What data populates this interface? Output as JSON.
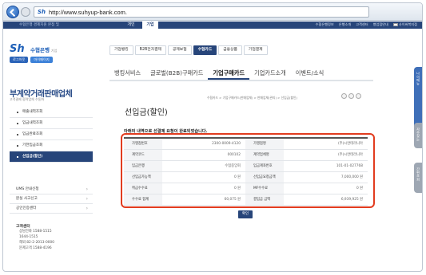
{
  "browser": {
    "url": "http://www.suhyup-bank.com."
  },
  "top": {
    "brand_note": "수협은행 경제지원 본점 및",
    "tab_personal": "개인",
    "tab_corporate": "기업",
    "links": [
      "수협은행정보",
      "은행소개",
      "고객센터",
      "병업점안내",
      "사이버북지점"
    ]
  },
  "logo": {
    "mark": "Sh",
    "name": "수협은행",
    "sub": "기업"
  },
  "logo_buttons": {
    "login": "로그아웃",
    "mypage": "마이페이지"
  },
  "sidebar": {
    "title": "부계약거래판매업체",
    "subtitle": "고객결제 협력업체 수동화",
    "items": [
      {
        "label": "매출내역조회",
        "active": false
      },
      {
        "label": "입금내역조회",
        "active": false
      },
      {
        "label": "입금완료조회",
        "active": false
      },
      {
        "label": "기한입금조회",
        "active": false
      },
      {
        "label": "선입금(할인)",
        "active": true
      }
    ],
    "secondary": [
      "UMS 안내신청",
      "분실 사고신고",
      "공인인증센터"
    ],
    "callcenter": {
      "title": "고객센터",
      "lines": [
        "상담전화  1588-1515",
        "               1644-1515",
        "해외       82-2-2013-0000",
        "문제고객  1588-4196"
      ]
    }
  },
  "main_menu": [
    {
      "label": "기업뱅킹",
      "on": false
    },
    {
      "label": "B2B전자결제",
      "on": false
    },
    {
      "label": "공제보험",
      "on": false
    },
    {
      "label": "수협카드",
      "on": true
    },
    {
      "label": "금융상품",
      "on": false
    },
    {
      "label": "기업결제",
      "on": false
    }
  ],
  "sub_menu": [
    {
      "label": "뱅킹서비스",
      "on": false
    },
    {
      "label": "글로벌(B2B)구매카드",
      "on": false
    },
    {
      "label": "기업구매카드",
      "on": true
    },
    {
      "label": "기업카드소개",
      "on": false
    },
    {
      "label": "이벤트/소식",
      "on": false
    }
  ],
  "breadcrumb": "수협카드 > 기업구매카드(판매업체) > 판매업체(관리) > 선입금(할인)",
  "page": {
    "title": "선입금(할인)",
    "notice": "아래의 내역으로 선결제 요청이 완료되었습니다."
  },
  "table": [
    {
      "l1": "가맹점번호",
      "v1": "2300-0009-4120",
      "l2": "가맹점명",
      "v2": "(주)시연테라니아"
    },
    {
      "l1": "계약코드",
      "v1": "000102",
      "l2": "계약업체명",
      "v2": "(주)시연테라니아"
    },
    {
      "l1": "입금은행",
      "v1": "수협중앙회",
      "l2": "입금계좌번호",
      "v2": "101-01-027768"
    },
    {
      "l1": "선입금가능액",
      "v1": "0 원",
      "l2": "선입금요청금액",
      "v2": "7,000,000 원"
    },
    {
      "l1": "취급수수료",
      "v1": "0 원",
      "l2": "MF수수료",
      "v2": "0 원"
    },
    {
      "l1": "수수료 합계",
      "v1": "60,075 원",
      "l2": "결입금 금액",
      "v2": "6,939,925 원"
    }
  ],
  "confirm_label": "확인",
  "side_tabs": [
    "나의메뉴",
    "자주찾는",
    "간편조회"
  ],
  "colors": {
    "navy": "#27457a",
    "highlight": "#e23c1f",
    "brand_blue": "#1d5fb8"
  }
}
